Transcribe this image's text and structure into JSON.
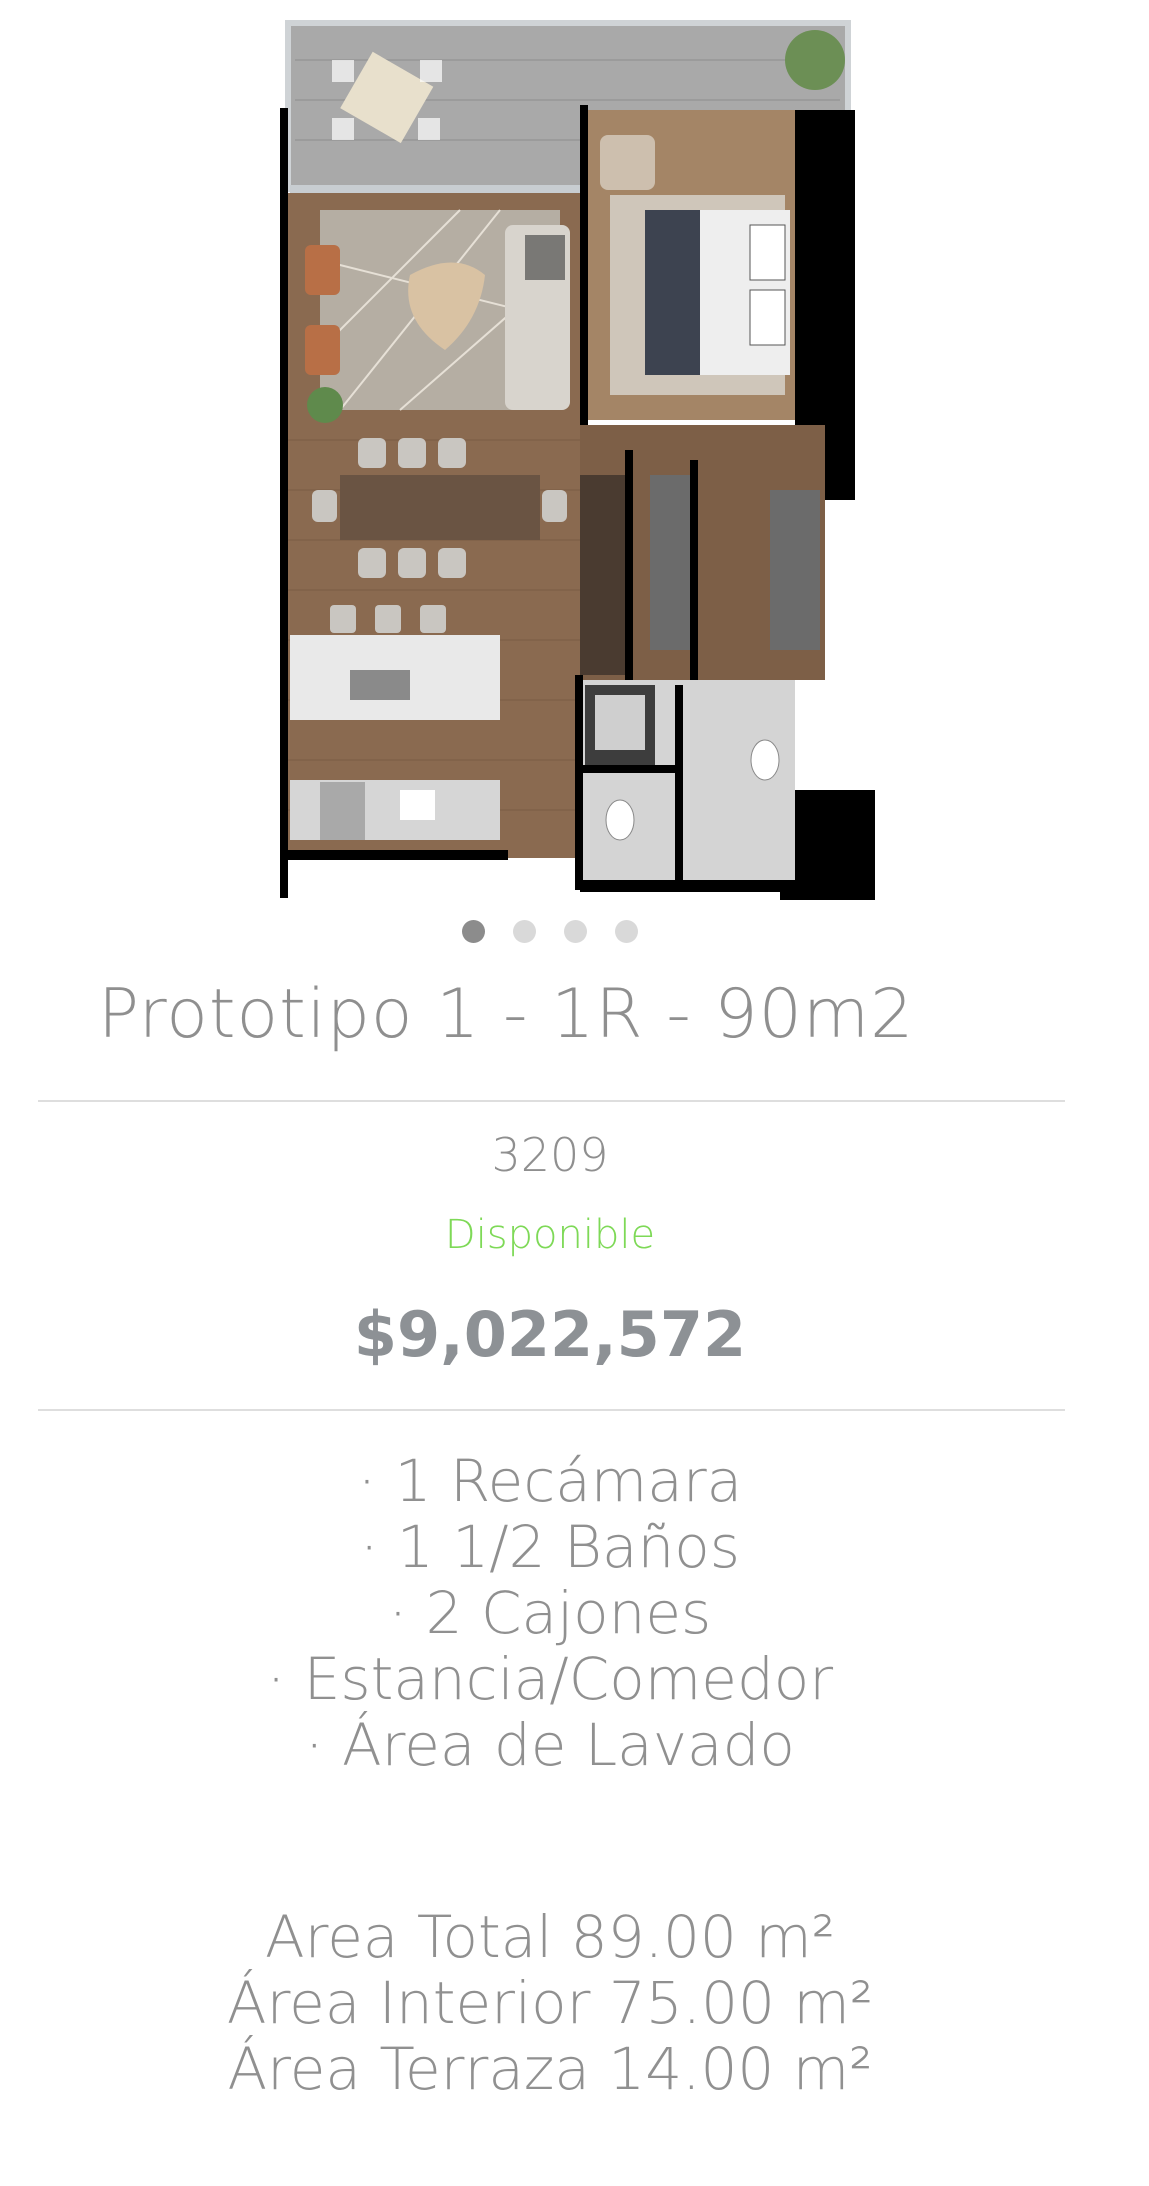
{
  "carousel": {
    "slide_count": 4,
    "active_index": 0
  },
  "title": "Prototipo 1 - 1R - 90m2",
  "unit_number": "3209",
  "status": {
    "label": "Disponible",
    "color": "#7ed957"
  },
  "price": "$9,022,572",
  "features": [
    "· 1 Recámara",
    "· 1 1/2 Baños",
    "· 2 Cajones",
    "· Estancia/Comedor",
    "· Área de Lavado"
  ],
  "areas": [
    "Area Total 89.00 m²",
    "Área Interior 75.00 m²",
    "Área Terraza 14.00 m²"
  ]
}
